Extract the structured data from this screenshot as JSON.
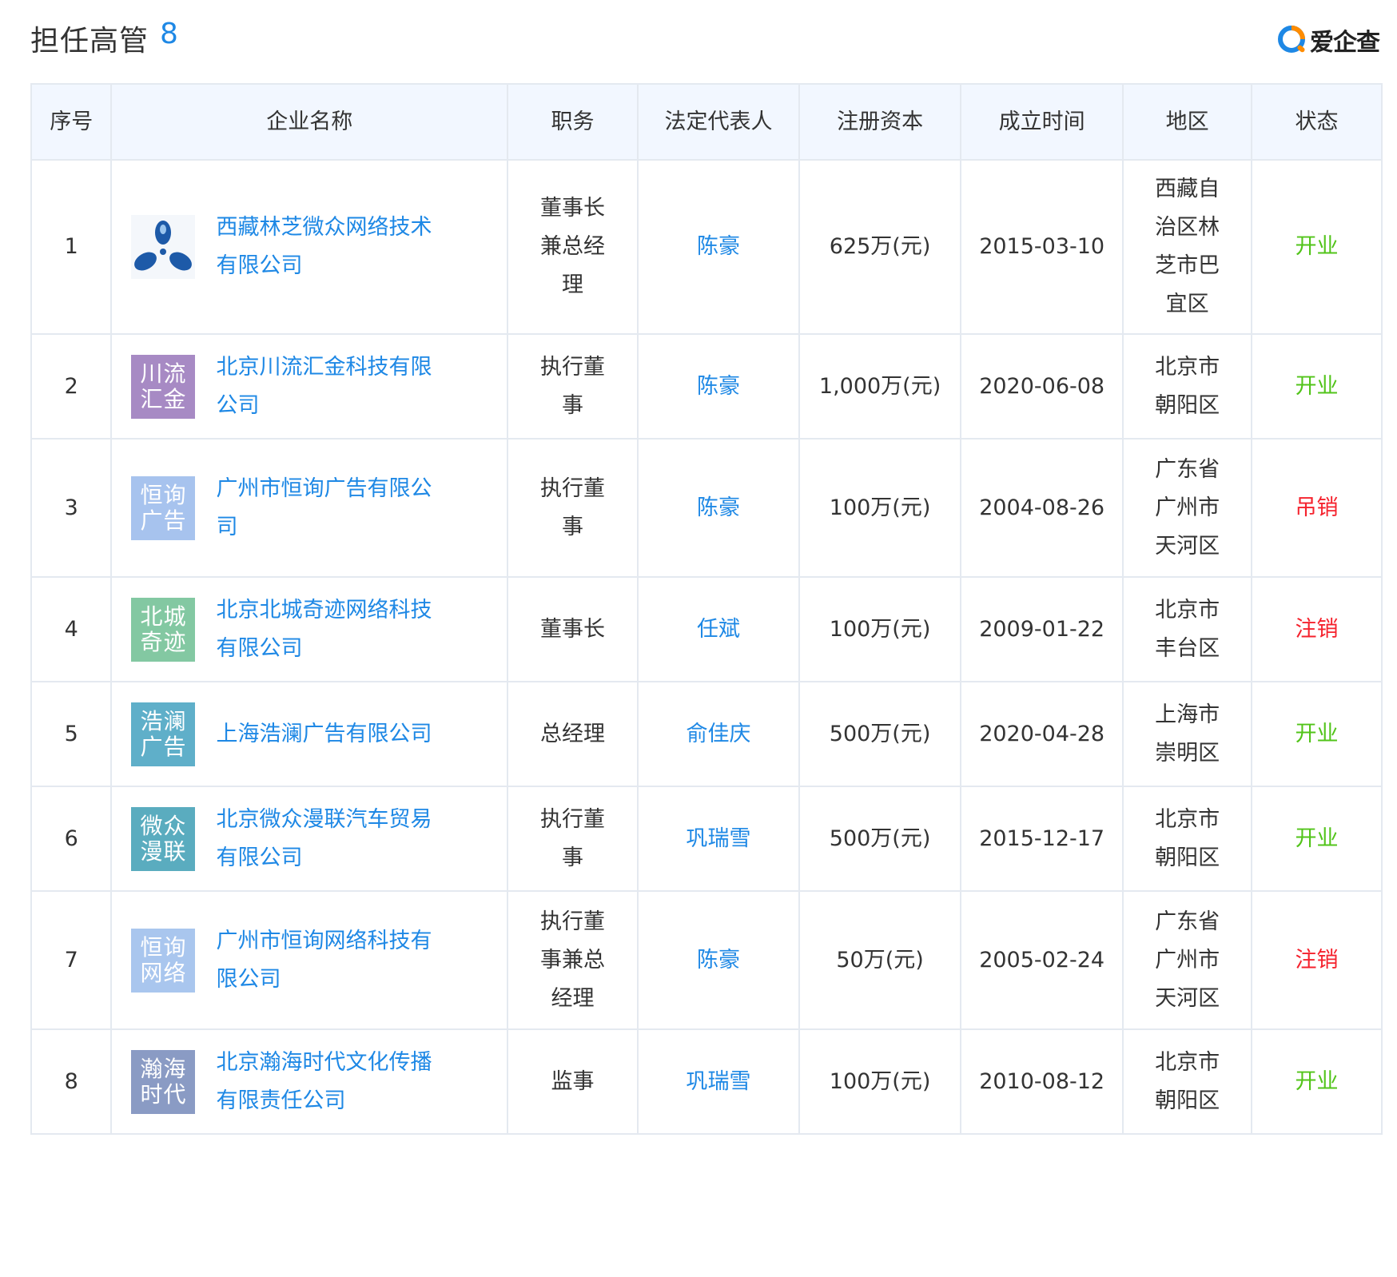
{
  "header": {
    "title": "担任高管",
    "count": "8"
  },
  "brand": {
    "name": "爱企查",
    "colors": {
      "blue": "#1e88e5",
      "orange": "#ff8c00"
    }
  },
  "table": {
    "columns": [
      "序号",
      "企业名称",
      "职务",
      "法定代表人",
      "注册资本",
      "成立时间",
      "地区",
      "状态"
    ],
    "rows": [
      {
        "index": "1",
        "logo_type": "image",
        "logo_line1": "",
        "logo_line2": "",
        "logo_color": "#ffffff",
        "company": "西藏林芝微众网络技术有限公司",
        "position": "董事长兼总经理",
        "legal_rep": "陈豪",
        "capital": "625万(元)",
        "founded": "2015-03-10",
        "region": "西藏自治区林芝市巴宜区",
        "status": "开业",
        "status_color": "#52c41a"
      },
      {
        "index": "2",
        "logo_type": "text",
        "logo_line1": "川流",
        "logo_line2": "汇金",
        "logo_color": "#a78ac4",
        "company": "北京川流汇金科技有限公司",
        "position": "执行董事",
        "legal_rep": "陈豪",
        "capital": "1,000万(元)",
        "founded": "2020-06-08",
        "region": "北京市朝阳区",
        "status": "开业",
        "status_color": "#52c41a"
      },
      {
        "index": "3",
        "logo_type": "text",
        "logo_line1": "恒询",
        "logo_line2": "广告",
        "logo_color": "#a7c3ee",
        "company": "广州市恒询广告有限公司",
        "position": "执行董事",
        "legal_rep": "陈豪",
        "capital": "100万(元)",
        "founded": "2004-08-26",
        "region": "广东省广州市天河区",
        "status": "吊销",
        "status_color": "#f5222d"
      },
      {
        "index": "4",
        "logo_type": "text",
        "logo_line1": "北城",
        "logo_line2": "奇迹",
        "logo_color": "#83c8a2",
        "company": "北京北城奇迹网络科技有限公司",
        "position": "董事长",
        "legal_rep": "任斌",
        "capital": "100万(元)",
        "founded": "2009-01-22",
        "region": "北京市丰台区",
        "status": "注销",
        "status_color": "#f5222d"
      },
      {
        "index": "5",
        "logo_type": "text",
        "logo_line1": "浩澜",
        "logo_line2": "广告",
        "logo_color": "#5fafc9",
        "company": "上海浩澜广告有限公司",
        "position": "总经理",
        "legal_rep": "俞佳庆",
        "capital": "500万(元)",
        "founded": "2020-04-28",
        "region": "上海市崇明区",
        "status": "开业",
        "status_color": "#52c41a"
      },
      {
        "index": "6",
        "logo_type": "text",
        "logo_line1": "微众",
        "logo_line2": "漫联",
        "logo_color": "#5aacbf",
        "company": "北京微众漫联汽车贸易有限公司",
        "position": "执行董事",
        "legal_rep": "巩瑞雪",
        "capital": "500万(元)",
        "founded": "2015-12-17",
        "region": "北京市朝阳区",
        "status": "开业",
        "status_color": "#52c41a"
      },
      {
        "index": "7",
        "logo_type": "text",
        "logo_line1": "恒询",
        "logo_line2": "网络",
        "logo_color": "#a9c6ee",
        "company": "广州市恒询网络科技有限公司",
        "position": "执行董事兼总经理",
        "legal_rep": "陈豪",
        "capital": "50万(元)",
        "founded": "2005-02-24",
        "region": "广东省广州市天河区",
        "status": "注销",
        "status_color": "#f5222d"
      },
      {
        "index": "8",
        "logo_type": "text",
        "logo_line1": "瀚海",
        "logo_line2": "时代",
        "logo_color": "#8a9bc4",
        "company": "北京瀚海时代文化传播有限责任公司",
        "position": "监事",
        "legal_rep": "巩瑞雪",
        "capital": "100万(元)",
        "founded": "2010-08-12",
        "region": "北京市朝阳区",
        "status": "开业",
        "status_color": "#52c41a"
      }
    ]
  }
}
